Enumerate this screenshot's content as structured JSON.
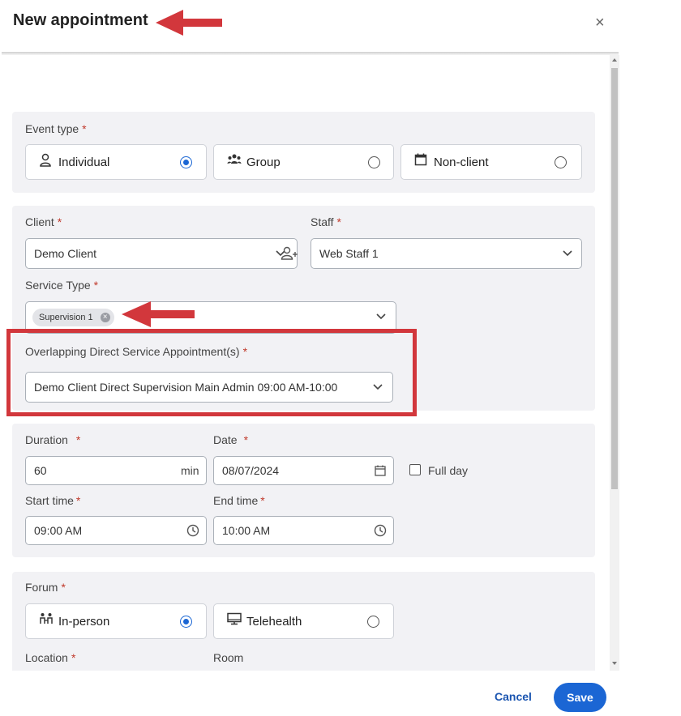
{
  "dialog": {
    "title": "New appointment",
    "close_glyph": "×"
  },
  "event_type": {
    "label": "Event type",
    "options": [
      {
        "label": "Individual",
        "icon": "person-icon",
        "selected": true
      },
      {
        "label": "Group",
        "icon": "group-icon",
        "selected": false
      },
      {
        "label": "Non-client",
        "icon": "calendar-icon",
        "selected": false
      }
    ]
  },
  "client": {
    "label": "Client",
    "value": "Demo Client"
  },
  "staff": {
    "label": "Staff",
    "value": "Web Staff 1"
  },
  "service_type": {
    "label": "Service Type",
    "chip": "Supervision 1",
    "chip_remove_glyph": "×"
  },
  "overlapping": {
    "label": "Overlapping Direct Service Appointment(s)",
    "value": "Demo Client Direct Supervision Main Admin 09:00 AM-10:00"
  },
  "duration": {
    "label": "Duration",
    "value": "60",
    "unit": "min"
  },
  "date": {
    "label": "Date",
    "value": "08/07/2024"
  },
  "full_day": {
    "label": "Full day",
    "checked": false
  },
  "start_time": {
    "label": "Start time",
    "value": "09:00 AM"
  },
  "end_time": {
    "label": "End time",
    "value": "10:00 AM"
  },
  "forum": {
    "label": "Forum",
    "options": [
      {
        "label": "In-person",
        "icon": "in-person-icon",
        "selected": true
      },
      {
        "label": "Telehealth",
        "icon": "monitor-icon",
        "selected": false
      }
    ]
  },
  "location": {
    "label": "Location"
  },
  "room": {
    "label": "Room"
  },
  "required_mark": "*",
  "footer": {
    "cancel_label": "Cancel",
    "save_label": "Save"
  },
  "colors": {
    "primary": "#1b66d4",
    "annotation_red": "#d2373c",
    "section_bg": "#f2f2f5"
  }
}
